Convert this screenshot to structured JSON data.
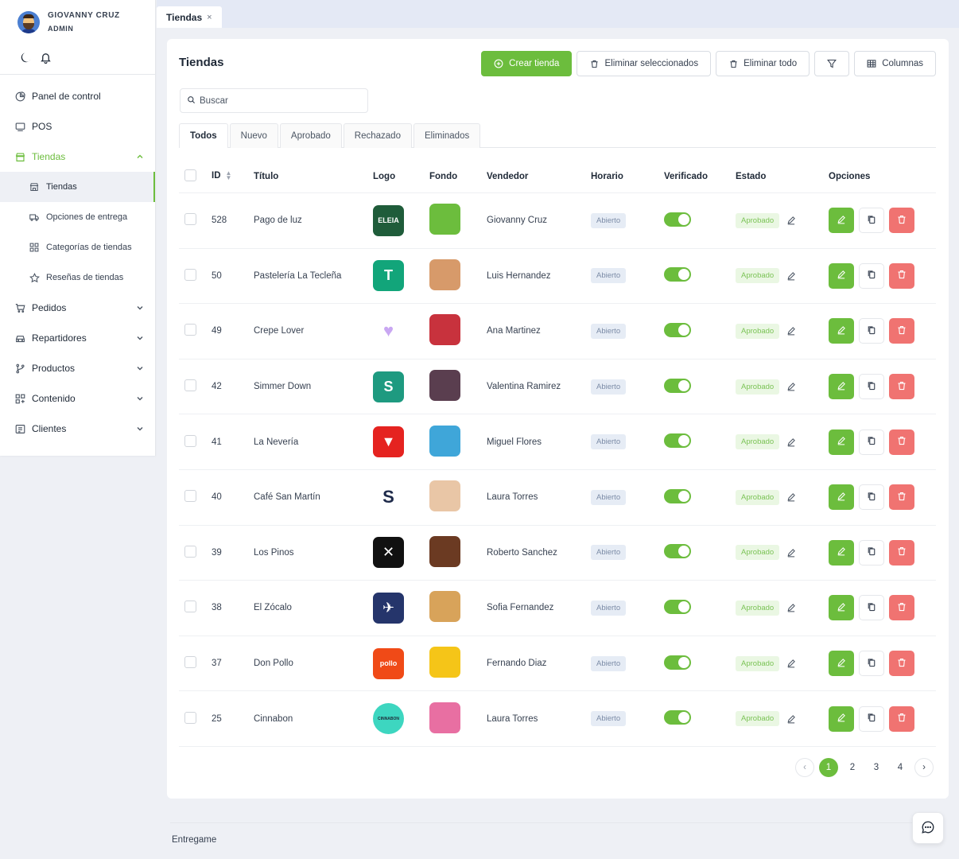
{
  "user": {
    "name": "GIOVANNY CRUZ",
    "role": "ADMIN"
  },
  "sidebar": {
    "items": [
      {
        "label": "Panel de control",
        "icon": "pie-chart-icon"
      },
      {
        "label": "POS",
        "icon": "monitor-icon"
      },
      {
        "label": "Tiendas",
        "icon": "store-icon",
        "expanded": true
      },
      {
        "label": "Pedidos",
        "icon": "cart-icon"
      },
      {
        "label": "Repartidores",
        "icon": "car-icon"
      },
      {
        "label": "Productos",
        "icon": "branch-icon"
      },
      {
        "label": "Contenido",
        "icon": "grid-icon"
      },
      {
        "label": "Clientes",
        "icon": "contact-card-icon"
      }
    ],
    "subitems": [
      {
        "label": "Tiendas",
        "icon": "store-icon",
        "active": true
      },
      {
        "label": "Opciones de entrega",
        "icon": "truck-icon"
      },
      {
        "label": "Categorías de tiendas",
        "icon": "grid-icon"
      },
      {
        "label": "Reseñas de tiendas",
        "icon": "star-icon"
      }
    ]
  },
  "window_tab": {
    "label": "Tiendas",
    "close": "×"
  },
  "page": {
    "title": "Tiendas",
    "buttons": {
      "create": "Crear tienda",
      "delete_selected": "Eliminar seleccionados",
      "delete_all": "Eliminar todo",
      "columns": "Columnas"
    },
    "search_placeholder": "Buscar",
    "filter_tabs": [
      "Todos",
      "Nuevo",
      "Aprobado",
      "Rechazado",
      "Eliminados"
    ],
    "active_filter": "Todos"
  },
  "table": {
    "headers": {
      "id": "ID",
      "title": "Título",
      "logo": "Logo",
      "fondo": "Fondo",
      "vendor": "Vendedor",
      "hours": "Horario",
      "verified": "Verificado",
      "status": "Estado",
      "options": "Opciones"
    },
    "rows": [
      {
        "id": "528",
        "title": "Pago de luz",
        "vendor": "Giovanny Cruz",
        "hours": "Abierto",
        "verified": true,
        "status": "Aprobado",
        "logo_text": "ELEIA",
        "logo_bg": "#1f5c3a",
        "fondo_bg": "#6cbd3d"
      },
      {
        "id": "50",
        "title": "Pastelería La Tecleña",
        "vendor": "Luis Hernandez",
        "hours": "Abierto",
        "verified": true,
        "status": "Aprobado",
        "logo_text": "T",
        "logo_bg": "#12a57a",
        "fondo_bg": "#d79a6a"
      },
      {
        "id": "49",
        "title": "Crepe Lover",
        "vendor": "Ana Martinez",
        "hours": "Abierto",
        "verified": true,
        "status": "Aprobado",
        "logo_text": "♥",
        "logo_bg": "#ffffff",
        "fondo_bg": "#c8323d"
      },
      {
        "id": "42",
        "title": "Simmer Down",
        "vendor": "Valentina Ramirez",
        "hours": "Abierto",
        "verified": true,
        "status": "Aprobado",
        "logo_text": "S",
        "logo_bg": "#1e9a80",
        "fondo_bg": "#5a3e4f"
      },
      {
        "id": "41",
        "title": "La Nevería",
        "vendor": "Miguel Flores",
        "hours": "Abierto",
        "verified": true,
        "status": "Aprobado",
        "logo_text": "▼",
        "logo_bg": "#e52320",
        "fondo_bg": "#3fa6d9"
      },
      {
        "id": "40",
        "title": "Café San Martín",
        "vendor": "Laura Torres",
        "hours": "Abierto",
        "verified": true,
        "status": "Aprobado",
        "logo_text": "S",
        "logo_bg": "#ffffff",
        "fondo_bg": "#e9c6a6"
      },
      {
        "id": "39",
        "title": "Los Pinos",
        "vendor": "Roberto Sanchez",
        "hours": "Abierto",
        "verified": true,
        "status": "Aprobado",
        "logo_text": "✕",
        "logo_bg": "#111111",
        "fondo_bg": "#6b3a22"
      },
      {
        "id": "38",
        "title": "El Zócalo",
        "vendor": "Sofia Fernandez",
        "hours": "Abierto",
        "verified": true,
        "status": "Aprobado",
        "logo_text": "✈",
        "logo_bg": "#25356b",
        "fondo_bg": "#d8a35a"
      },
      {
        "id": "37",
        "title": "Don Pollo",
        "vendor": "Fernando Diaz",
        "hours": "Abierto",
        "verified": true,
        "status": "Aprobado",
        "logo_text": "pollo",
        "logo_bg": "#f04a17",
        "fondo_bg": "#f5c518"
      },
      {
        "id": "25",
        "title": "Cinnabon",
        "vendor": "Laura Torres",
        "hours": "Abierto",
        "verified": true,
        "status": "Aprobado",
        "logo_text": "CINNABON",
        "logo_bg": "#3dd6c0",
        "fondo_bg": "#e86fa2"
      }
    ]
  },
  "pagination": {
    "pages": [
      "1",
      "2",
      "3",
      "4"
    ],
    "current": "1"
  },
  "footer": {
    "text": "Entregame"
  },
  "colors": {
    "accent": "#6cbd3d",
    "danger": "#f07371"
  }
}
